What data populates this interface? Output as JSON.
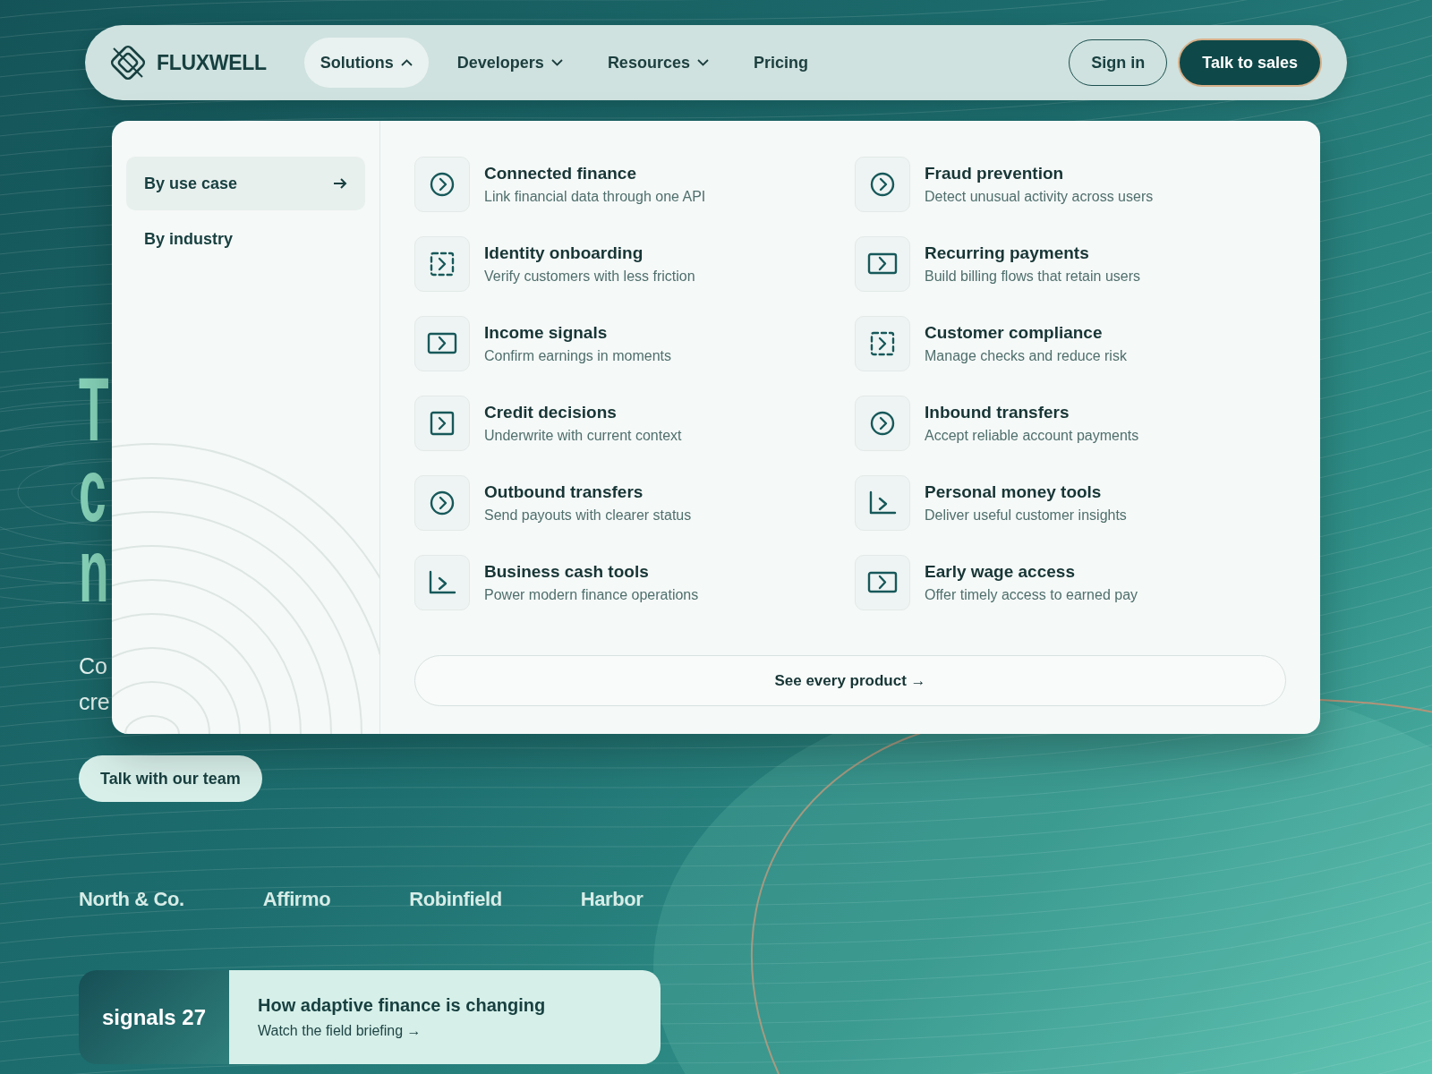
{
  "nav": {
    "logo": "FLUXWELL",
    "items": [
      {
        "label": "Solutions",
        "kind": "menu",
        "expanded": true
      },
      {
        "label": "Developers",
        "kind": "menu",
        "expanded": false
      },
      {
        "label": "Resources",
        "kind": "menu",
        "expanded": false
      },
      {
        "label": "Pricing",
        "kind": "link",
        "expanded": false
      }
    ],
    "sign_in": "Sign in",
    "cta": "Talk to sales"
  },
  "hero": {
    "heading_lines": [
      "T",
      "c",
      "n"
    ],
    "subtitle_lines": [
      "Co",
      "cre"
    ],
    "button": "Talk with our team"
  },
  "logos": [
    "North & Co.",
    "Affirmo",
    "Robinfield",
    "Harbor"
  ],
  "banner": {
    "tag": "signals 27",
    "title": "How adaptive finance is changing",
    "link": "Watch the field briefing →"
  },
  "dropdown": {
    "categories": [
      {
        "label": "By use case",
        "selected": true
      },
      {
        "label": "By industry",
        "selected": false
      }
    ],
    "products": [
      {
        "title": "Connected finance",
        "description": "Link financial data through one API",
        "kind": "circle"
      },
      {
        "title": "Fraud prevention",
        "description": "Detect unusual activity across users",
        "kind": "circle"
      },
      {
        "title": "Identity onboarding",
        "description": "Verify customers with less friction",
        "kind": "dashed"
      },
      {
        "title": "Recurring payments",
        "description": "Build billing flows that retain users",
        "kind": "wide"
      },
      {
        "title": "Income signals",
        "description": "Confirm earnings in moments",
        "kind": "wide"
      },
      {
        "title": "Customer compliance",
        "description": "Manage checks and reduce risk",
        "kind": "dashed"
      },
      {
        "title": "Credit decisions",
        "description": "Underwrite with current context",
        "kind": "square"
      },
      {
        "title": "Inbound transfers",
        "description": "Accept reliable account payments",
        "kind": "circle"
      },
      {
        "title": "Outbound transfers",
        "description": "Send payouts with clearer status",
        "kind": "circle"
      },
      {
        "title": "Personal money tools",
        "description": "Deliver useful customer insights",
        "kind": "corner"
      },
      {
        "title": "Business cash tools",
        "description": "Power modern finance operations",
        "kind": "corner"
      },
      {
        "title": "Early wage access",
        "description": "Offer timely access to earned pay",
        "kind": "wide"
      }
    ],
    "footer_button": "See every product →"
  }
}
